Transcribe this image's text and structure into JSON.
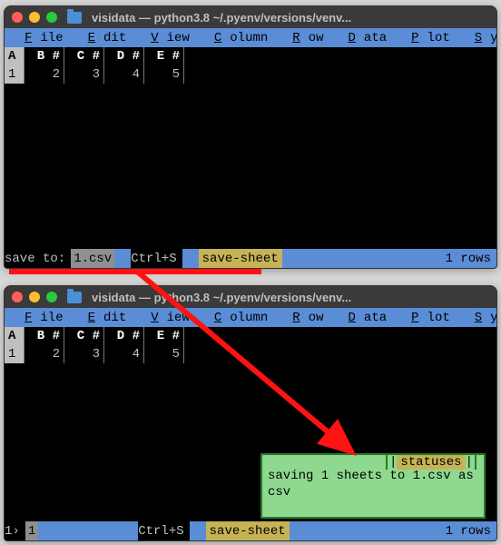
{
  "window_title": "visidata — python3.8 ~/.pyenv/versions/venv...",
  "menu": {
    "file": "File",
    "edit": "Edit",
    "view": "View",
    "column": "Column",
    "row": "Row",
    "data": "Data",
    "plot": "Plot",
    "system": "System"
  },
  "sheet": {
    "headers": [
      "A",
      "B #",
      "C #",
      "D #",
      "E #"
    ],
    "rows": [
      [
        "1",
        "2",
        "3",
        "4",
        "5"
      ]
    ]
  },
  "status1": {
    "prompt": "save to:",
    "input_value": "1.csv",
    "key_hint": "Ctrl+S",
    "command": "save-sheet",
    "rows_text": "1 rows"
  },
  "status2": {
    "left_marker": "1›",
    "left_value": "1",
    "key_hint": "Ctrl+S",
    "command": "save-sheet",
    "rows_text": "1 rows"
  },
  "status_popup": {
    "tab_label": "statuses",
    "message": "saving 1 sheets to 1.csv as csv"
  }
}
